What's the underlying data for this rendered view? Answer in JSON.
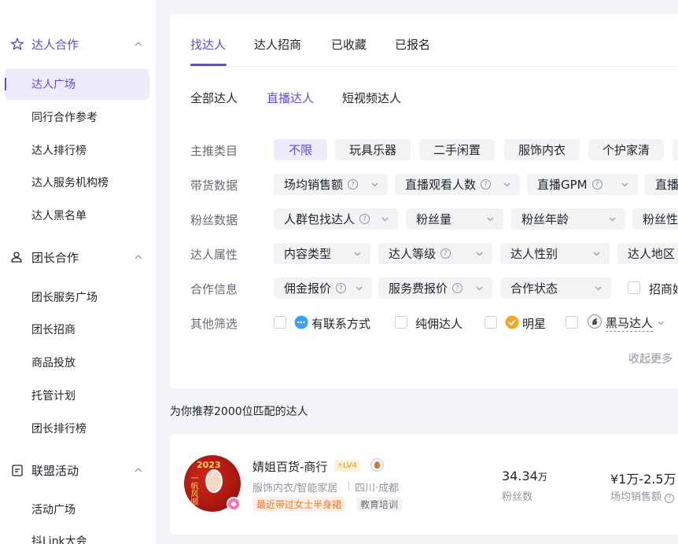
{
  "sidebar": {
    "groups": [
      {
        "label": "达人合作",
        "items": [
          "达人广场",
          "同行合作参考",
          "达人排行榜",
          "达人服务机构榜",
          "达人黑名单"
        ]
      },
      {
        "label": "团长合作",
        "items": [
          "团长服务广场",
          "团长招商",
          "商品投放",
          "托管计划",
          "团长排行榜"
        ]
      },
      {
        "label": "联盟活动",
        "items": [
          "活动广场",
          "抖Link大会"
        ]
      }
    ]
  },
  "tabs": [
    "找达人",
    "达人招商",
    "已收藏",
    "已报名"
  ],
  "subtabs": [
    "全部达人",
    "直播达人",
    "短视频达人"
  ],
  "filters": {
    "category": {
      "label": "主推类目",
      "options": [
        "不限",
        "玩具乐器",
        "二手闲置",
        "服饰内衣",
        "个护家清"
      ]
    },
    "sales": {
      "label": "带货数据",
      "options": [
        "场均销售额",
        "直播观看人数",
        "直播GPM",
        "直播"
      ]
    },
    "fans": {
      "label": "粉丝数据",
      "options": [
        "人群包找达人",
        "粉丝量",
        "粉丝年龄",
        "粉丝性"
      ]
    },
    "attr": {
      "label": "达人属性",
      "options": [
        "内容类型",
        "达人等级",
        "达人性别",
        "达人地区"
      ]
    },
    "coop": {
      "label": "合作信息",
      "options": [
        "佣金报价",
        "服务费报价",
        "合作状态"
      ],
      "checkbox": "招商好"
    },
    "other": {
      "label": "其他筛选",
      "options": [
        "有联系方式",
        "纯佣达人",
        "明星",
        "黑马达人"
      ]
    }
  },
  "collapse_more": "收起更多",
  "recommend_text": "为你推荐2000位匹配的达人",
  "card": {
    "name": "婧姐百货-商行",
    "level": "LV4",
    "category": "服饰内衣/智能家居",
    "location": "四川·成都",
    "recent_tag": "最近带过女士半身裙",
    "tag": "教育培训",
    "avatar_year": "2023",
    "avatar_text": "一帆风顺",
    "fans_value": "34.34",
    "fans_unit": "万",
    "fans_label": "粉丝数",
    "sales_value": "¥1万-2.5万",
    "sales_label": "场均销售额"
  },
  "colors": {
    "accent": "#5b4ce6",
    "orange": "#f5742a",
    "muted": "#8f959e"
  }
}
